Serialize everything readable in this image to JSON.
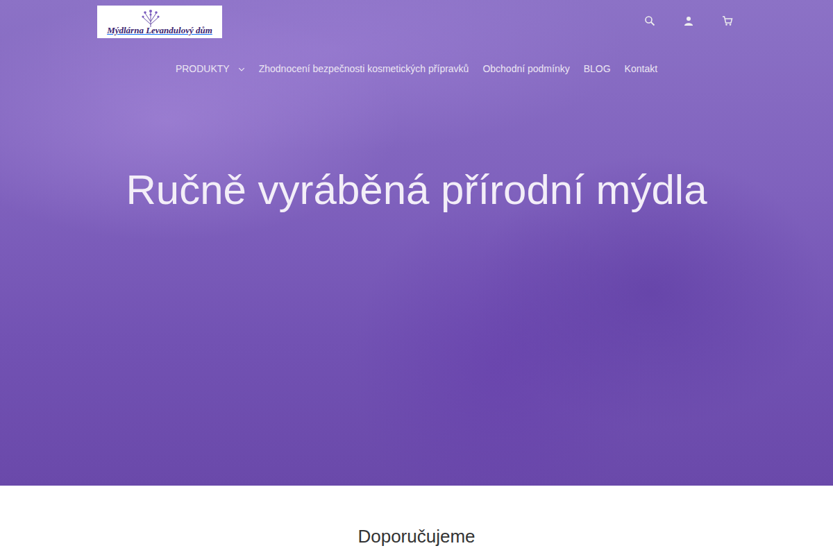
{
  "logo": {
    "text": "Mýdlárna Levandulový dům"
  },
  "nav": [
    {
      "label": "PRODUKTY",
      "kind": "dropdown"
    },
    {
      "label": "Zhodnocení bezpečnosti kosmetických přípravků",
      "kind": "link"
    },
    {
      "label": "Obchodní podmínky",
      "kind": "link"
    },
    {
      "label": "BLOG",
      "kind": "link"
    },
    {
      "label": "Kontakt",
      "kind": "link"
    }
  ],
  "hero": {
    "title": "Ručně vyráběná přírodní mýdla"
  },
  "section": {
    "title": "Doporučujeme"
  }
}
